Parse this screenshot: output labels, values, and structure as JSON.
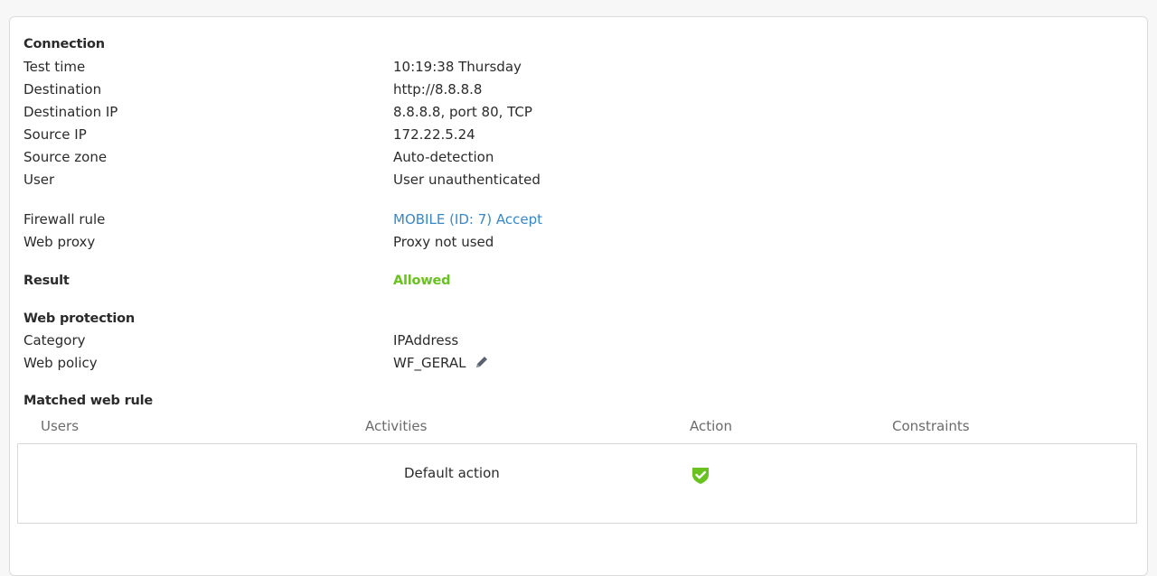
{
  "connection": {
    "heading": "Connection",
    "rows": [
      {
        "label": "Test time",
        "value": "10:19:38 Thursday"
      },
      {
        "label": "Destination",
        "value": "http://8.8.8.8"
      },
      {
        "label": "Destination IP",
        "value": "8.8.8.8, port 80, TCP"
      },
      {
        "label": "Source IP",
        "value": "172.22.5.24"
      },
      {
        "label": "Source zone",
        "value": "Auto-detection"
      },
      {
        "label": "User",
        "value": "User unauthenticated"
      }
    ]
  },
  "rules": {
    "firewall_label": "Firewall rule",
    "firewall_value": "MOBILE (ID: 7) Accept",
    "proxy_label": "Web proxy",
    "proxy_value": "Proxy not used"
  },
  "result": {
    "label": "Result",
    "value": "Allowed",
    "color": "#69c21f"
  },
  "web_protection": {
    "heading": "Web protection",
    "category_label": "Category",
    "category_value": "IPAddress",
    "policy_label": "Web policy",
    "policy_value": "WF_GERAL",
    "edit_icon": "pencil-icon"
  },
  "matched_rule": {
    "heading": "Matched web rule",
    "columns": [
      "Users",
      "Activities",
      "Action",
      "Constraints"
    ],
    "rows": [
      {
        "users": "",
        "activity": "Default action",
        "action_icon": "shield-check-icon",
        "constraints": ""
      }
    ]
  },
  "colors": {
    "link": "#3a87c6",
    "allowed": "#69c21f",
    "shield": "#69c21f"
  }
}
